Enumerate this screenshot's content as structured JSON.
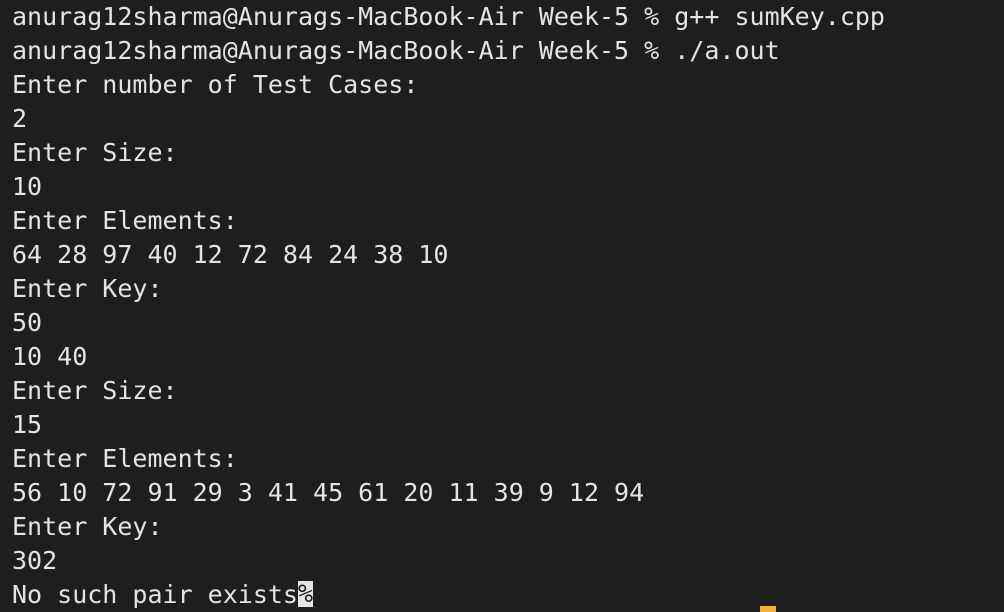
{
  "terminal": {
    "lines": [
      "anurag12sharma@Anurags-MacBook-Air Week-5 % g++ sumKey.cpp",
      "anurag12sharma@Anurags-MacBook-Air Week-5 % ./a.out",
      "Enter number of Test Cases:",
      "2",
      "Enter Size:",
      "10",
      "Enter Elements:",
      "64 28 97 40 12 72 84 24 38 10",
      "Enter Key:",
      "50",
      "10 40",
      "Enter Size:",
      "15",
      "Enter Elements:",
      "56 10 72 91 29 3 41 45 61 20 11 39 9 12 94",
      "Enter Key:",
      "302",
      "No such pair exists"
    ],
    "eol_mark": "%"
  },
  "colors": {
    "background": "#1e1e1e",
    "foreground": "#e4e4e4",
    "cursor": "#f2b33d"
  }
}
